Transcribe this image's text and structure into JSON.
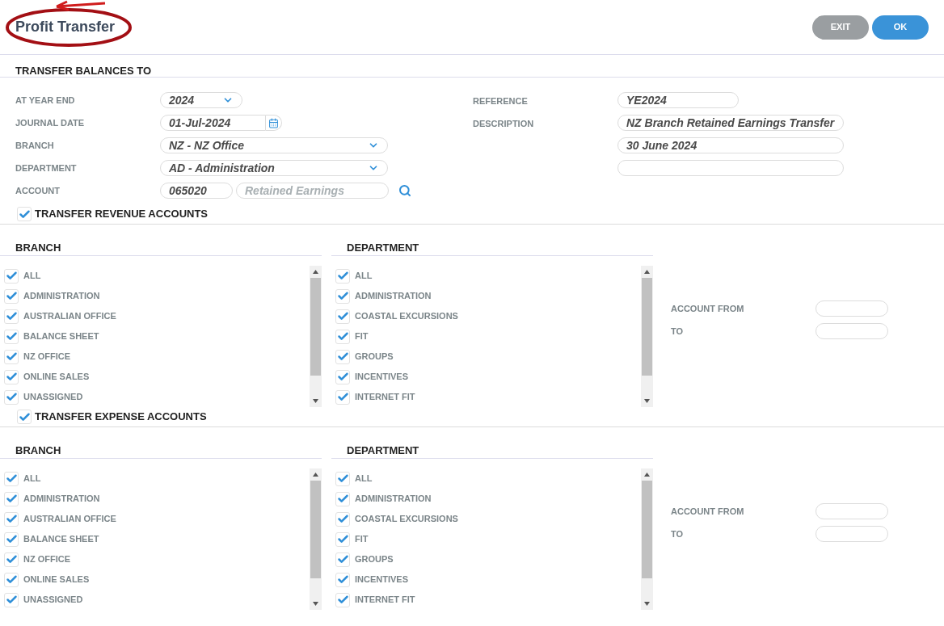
{
  "header": {
    "title": "Profit Transfer",
    "buttons": [
      {
        "label": "EXIT",
        "kind": "secondary"
      },
      {
        "label": "OK",
        "kind": "primary"
      }
    ]
  },
  "balances": {
    "heading": "TRANSFER BALANCES TO",
    "left_fields": [
      {
        "kind": "select",
        "label": "AT YEAR END",
        "value": "2024",
        "wide": false
      },
      {
        "kind": "date",
        "label": "JOURNAL DATE",
        "value": "01-Jul-2024"
      },
      {
        "kind": "select",
        "label": "BRANCH",
        "value": "NZ - NZ Office",
        "wide": true
      },
      {
        "kind": "select",
        "label": "DEPARTMENT",
        "value": "AD - Administration",
        "wide": true
      },
      {
        "kind": "lookup",
        "label": "ACCOUNT",
        "value": "065020",
        "name": "Retained Earnings"
      }
    ],
    "right_fields": [
      {
        "kind": "text",
        "label": "REFERENCE",
        "value": "YE2024",
        "wide": false
      },
      {
        "kind": "text",
        "label": "DESCRIPTION",
        "value": "NZ Branch Retained Earnings Transfer",
        "wide": true
      },
      {
        "kind": "text",
        "value": "30 June 2024",
        "wide": true
      },
      {
        "kind": "text",
        "wide": true
      }
    ]
  },
  "sections": [
    {
      "toggle": {
        "label": "TRANSFER REVENUE ACCOUNTS",
        "checked": true
      },
      "branch": {
        "heading": "BRANCH",
        "items": [
          {
            "label": "ALL",
            "checked": true
          },
          {
            "label": "ADMINISTRATION",
            "checked": true
          },
          {
            "label": "AUSTRALIAN OFFICE",
            "checked": true
          },
          {
            "label": "BALANCE SHEET",
            "checked": true
          },
          {
            "label": "NZ OFFICE",
            "checked": true
          },
          {
            "label": "ONLINE SALES",
            "checked": true
          },
          {
            "label": "UNASSIGNED",
            "checked": true
          }
        ]
      },
      "department": {
        "heading": "DEPARTMENT",
        "items": [
          {
            "label": "ALL",
            "checked": true
          },
          {
            "label": "ADMINISTRATION",
            "checked": true
          },
          {
            "label": "COASTAL EXCURSIONS",
            "checked": true
          },
          {
            "label": "FIT",
            "checked": true
          },
          {
            "label": "GROUPS",
            "checked": true
          },
          {
            "label": "INCENTIVES",
            "checked": true
          },
          {
            "label": "INTERNET FIT",
            "checked": true
          }
        ]
      },
      "account_from": "ACCOUNT FROM",
      "account_to": "TO"
    },
    {
      "toggle": {
        "label": "TRANSFER EXPENSE ACCOUNTS",
        "checked": true
      },
      "branch": {
        "heading": "BRANCH",
        "items": [
          {
            "label": "ALL",
            "checked": true
          },
          {
            "label": "ADMINISTRATION",
            "checked": true
          },
          {
            "label": "AUSTRALIAN OFFICE",
            "checked": true
          },
          {
            "label": "BALANCE SHEET",
            "checked": true
          },
          {
            "label": "NZ OFFICE",
            "checked": true
          },
          {
            "label": "ONLINE SALES",
            "checked": true
          },
          {
            "label": "UNASSIGNED",
            "checked": true
          }
        ]
      },
      "department": {
        "heading": "DEPARTMENT",
        "items": [
          {
            "label": "ALL",
            "checked": true
          },
          {
            "label": "ADMINISTRATION",
            "checked": true
          },
          {
            "label": "COASTAL EXCURSIONS",
            "checked": true
          },
          {
            "label": "FIT",
            "checked": true
          },
          {
            "label": "GROUPS",
            "checked": true
          },
          {
            "label": "INCENTIVES",
            "checked": true
          },
          {
            "label": "INTERNET FIT",
            "checked": true
          }
        ]
      },
      "account_from": "ACCOUNT FROM",
      "account_to": "TO"
    }
  ]
}
